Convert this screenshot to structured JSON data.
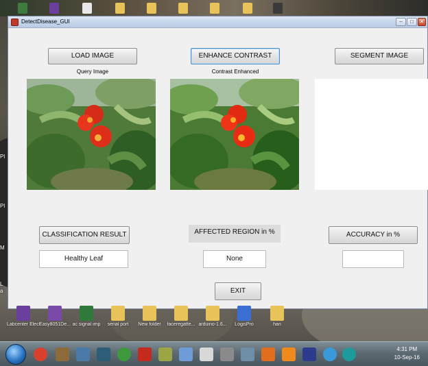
{
  "window": {
    "title": "DetectDisease_GUI",
    "controls": {
      "minimize": "–",
      "maximize": "□",
      "close": "✕"
    }
  },
  "buttons": {
    "load_image": "LOAD IMAGE",
    "enhance_contrast": "ENHANCE CONTRAST",
    "segment_image": "SEGMENT IMAGE",
    "classification_result": "CLASSIFICATION RESULT",
    "accuracy": "ACCURACY in %",
    "exit": "EXIT"
  },
  "labels": {
    "query_image": "Query Image",
    "contrast_enhanced": "Contrast Enhanced",
    "affected_region": "AFFECTED REGION in %"
  },
  "results": {
    "classification": "Healthy Leaf",
    "affected_region": "None",
    "accuracy": ""
  },
  "desktop_icons": [
    {
      "label": "Labcenter Electroni...",
      "icon": "winrar-icon",
      "color": "#6a3f9e"
    },
    {
      "label": "Easy8051De...",
      "icon": "winrar-icon",
      "color": "#7a4aa8"
    },
    {
      "label": "ac signal imp",
      "icon": "document-icon",
      "color": "#2f7a3a"
    },
    {
      "label": "serial port",
      "icon": "folder-icon",
      "color": "#e8c35a"
    },
    {
      "label": "New folder",
      "icon": "folder-icon",
      "color": "#e8c35a"
    },
    {
      "label": "faceregatte...",
      "icon": "folder-icon",
      "color": "#e8c35a"
    },
    {
      "label": "arduino-1.6...",
      "icon": "folder-icon",
      "color": "#e8c35a"
    },
    {
      "label": "LogisPro",
      "icon": "logispro-icon",
      "color": "#3b6fd1"
    },
    {
      "label": "hari",
      "icon": "folder-icon",
      "color": "#e8c35a"
    }
  ],
  "left_edge": [
    "Lab",
    "Pl",
    "Pl",
    "M",
    "L",
    "a"
  ],
  "taskbar": {
    "items": [
      {
        "icon": "chrome-icon",
        "color": "#d9412e"
      },
      {
        "icon": "app-icon",
        "color": "#8c6a3a"
      },
      {
        "icon": "network-icon",
        "color": "#4a7aa8"
      },
      {
        "icon": "terminal-icon",
        "color": "#2d5d78"
      },
      {
        "icon": "uTorrent-icon",
        "color": "#3c9a3c"
      },
      {
        "icon": "acrobat-icon",
        "color": "#c42b1e"
      },
      {
        "icon": "pen-icon",
        "color": "#9ca646"
      },
      {
        "icon": "note-icon",
        "color": "#6f9bd6"
      },
      {
        "icon": "document-icon",
        "color": "#d8d8d8"
      },
      {
        "icon": "drive-icon",
        "color": "#8a8a8a"
      },
      {
        "icon": "calculator-icon",
        "color": "#6f8fa9"
      },
      {
        "icon": "matlab-icon",
        "color": "#e06e1e"
      },
      {
        "icon": "vlc-icon",
        "color": "#f08a1c"
      },
      {
        "icon": "proteus-icon",
        "color": "#2c3b8c"
      },
      {
        "icon": "chrome-icon",
        "color": "#3a9ad9"
      },
      {
        "icon": "arduino-icon",
        "color": "#1f9a9a"
      }
    ],
    "clock_time": "4:31 PM",
    "clock_date": "10-Sep-16"
  }
}
